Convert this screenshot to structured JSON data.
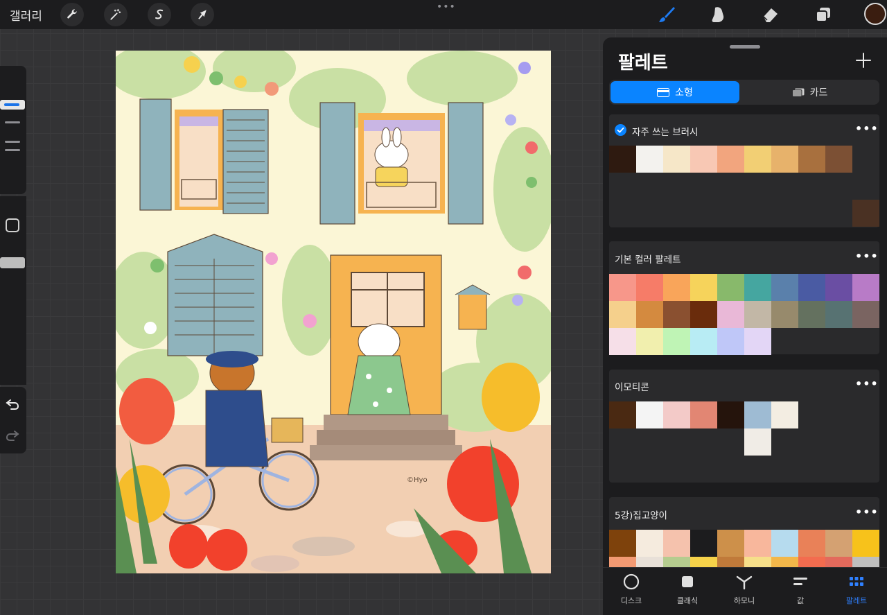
{
  "topbar": {
    "gallery_label": "갤러리",
    "tools": [
      "wrench-icon",
      "magic-wand-icon",
      "selection-s-icon",
      "transform-arrow-icon"
    ],
    "more": "•••",
    "right_tools": [
      "brush-icon",
      "smudge-icon",
      "eraser-icon",
      "layers-icon"
    ],
    "current_color": "#3a1d10"
  },
  "sidebar": {
    "undo": "undo-icon",
    "redo": "redo-icon"
  },
  "panel": {
    "title": "팔레트",
    "add": "+",
    "segments": {
      "compact": "소형",
      "cards": "카드"
    },
    "more": "•••",
    "palettes": [
      {
        "name": "자주 쓰는 브러시",
        "checked": true,
        "colors": [
          "#2e1a10",
          "#f3f2ee",
          "#f6e7c8",
          "#f8c8b4",
          "#f2a57e",
          "#f2cf74",
          "#e7b26b",
          "#a8703e",
          "#7c5034"
        ],
        "extra": [
          "#4a3123"
        ]
      },
      {
        "name": "기본 컬러 팔레트",
        "colors": [
          "#f7978a",
          "#f67c68",
          "#f9a55a",
          "#f6d35b",
          "#88b96b",
          "#45a6a0",
          "#5a80ab",
          "#4a5ba3",
          "#6a4ea3",
          "#b87bc7",
          "#f5d08c",
          "#d48a3f",
          "#8a5030",
          "#6a2c0c",
          "#e9b8d7",
          "#c2b7a6",
          "#978a6c",
          "#64715f",
          "#577272",
          "#7a6461",
          "#f6dfe8",
          "#f1efae",
          "#bff4b5",
          "#b8ecf4",
          "#bfc7f8",
          "#e3d6f6"
        ]
      },
      {
        "name": "이모티콘",
        "colors": [
          "#4a2912",
          "#f4f4f4",
          "#f3cac8",
          "#e28673",
          "#25140c",
          "#9ebbd3",
          "#f3ede2"
        ],
        "extra": [
          "#f0ece6"
        ]
      },
      {
        "name": "5강)집고양이",
        "colors": [
          "#7e420c",
          "#f5ebde",
          "#f5c2ad",
          "#1c1c1e",
          "#cd904a",
          "#f8b79c",
          "#b6dbee",
          "#e98158",
          "#d4a172",
          "#f7c21b"
        ],
        "row2": [
          "#f39a73",
          "#e8e0d8",
          "#b5cc8f",
          "#f6d24a",
          "#c07a3a",
          "#f6df8a",
          "#f3b74a",
          "#f36c4f",
          "#e36a5c",
          "#bfbfbf"
        ]
      }
    ]
  },
  "tabs": [
    {
      "label": "디스크",
      "icon": "disc-icon"
    },
    {
      "label": "클래식",
      "icon": "classic-square-icon"
    },
    {
      "label": "하모니",
      "icon": "harmony-icon"
    },
    {
      "label": "값",
      "icon": "value-sliders-icon"
    },
    {
      "label": "팔레트",
      "icon": "palette-grid-icon",
      "active": true
    }
  ],
  "artwork": {
    "signature": "©Hyo"
  }
}
